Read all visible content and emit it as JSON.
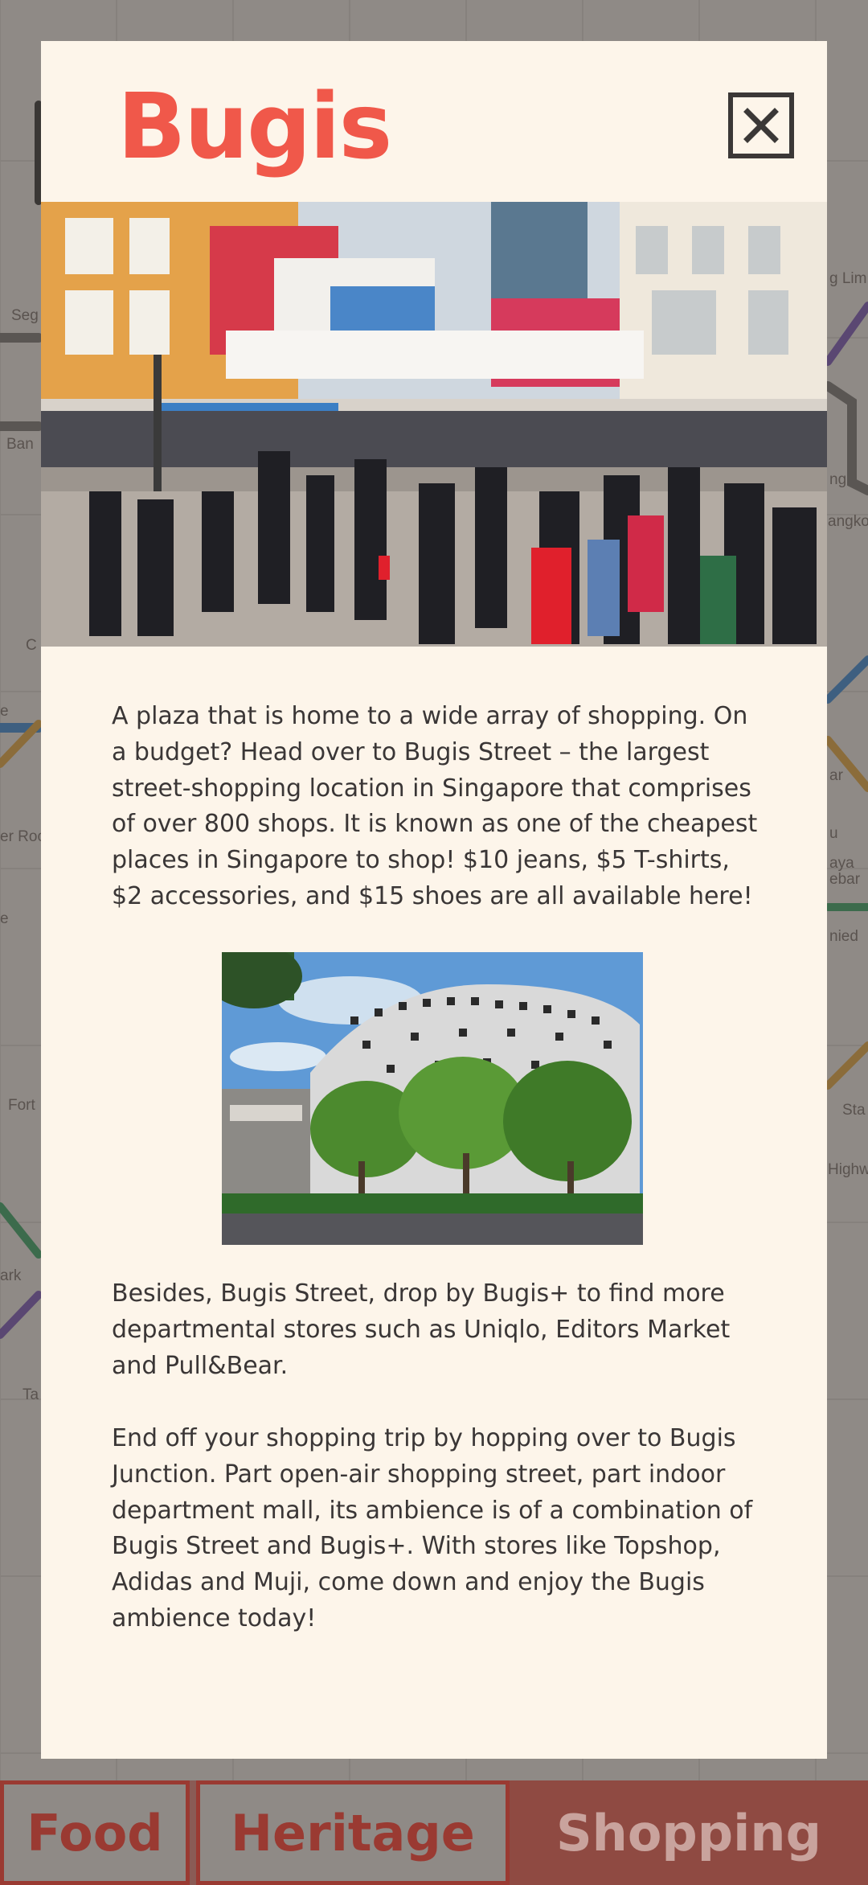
{
  "modal": {
    "title": "Bugis",
    "close_icon": "close-icon",
    "paragraphs": [
      "A plaza that is home to a wide array of shopping. On a budget? Head over to Bugis Street – the largest street-shopping location in Singapore that comprises of over 800 shops. It is known as one of the cheapest places in Singapore to shop! $10 jeans, $5 T-shirts, $2 accessories, and $15 shoes are all available here!",
      "Besides, Bugis Street, drop by Bugis+ to find more departmental stores such as Uniqlo, Editors Market and Pull&Bear.",
      "End off your shopping trip by hopping over to Bugis Junction. Part open-air shopping street, part indoor department mall, its ambience is of a combination of Bugis Street and Bugis+. With stores like Topshop, Adidas and Muji, come down and enjoy the Bugis ambience today!"
    ]
  },
  "map_labels": [
    "Seg",
    "Ban",
    "C",
    "e",
    "er Roo",
    "e",
    "Fort",
    "ark",
    "Ta",
    "g Lim",
    "ng",
    "angko",
    "ar",
    "u",
    "aya ebar",
    "nied",
    "Sta",
    "Highw"
  ],
  "bottom_nav": {
    "tabs": [
      "Food",
      "Heritage",
      "Shopping"
    ],
    "active": "Shopping"
  },
  "colors": {
    "title": "#f0584a",
    "modal_bg": "#fdf5ea",
    "nav_active": "#8f4a42",
    "nav_outline": "#9a3a32"
  }
}
